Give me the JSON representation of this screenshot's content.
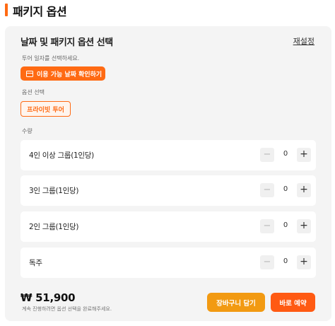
{
  "section": {
    "title": "패키지 옵션"
  },
  "panel": {
    "title": "날짜 및 패키지 옵션 선택",
    "reset_label": "재설정",
    "date_hint": "투어 일자를 선택하세요.",
    "date_button_label": "이용 가능 날짜 확인하기",
    "option_label": "옵션 선택",
    "option_chip": "프라이빗 투어",
    "quantity_label": "수량",
    "rows": [
      {
        "label": "4인 이상 그룹(1인당)",
        "value": "0"
      },
      {
        "label": "3인 그룹(1인당)",
        "value": "0"
      },
      {
        "label": "2인 그룹(1인당)",
        "value": "0"
      },
      {
        "label": "독주",
        "value": "0"
      }
    ],
    "minus_symbol": "−",
    "plus_symbol": "+",
    "price": "₩ 51,900",
    "price_note": "계속 진행하려면 옵션 선택을 완료해주세요.",
    "cart_button_label": "장바구니 담기",
    "book_button_label": "바로 예약"
  },
  "colors": {
    "accent": "#ff6a13",
    "cart": "#f29a12",
    "book": "#ff5a13",
    "panel_bg": "#f4f4f4"
  },
  "icons": {
    "date_button_icon": "calendar-icon"
  }
}
